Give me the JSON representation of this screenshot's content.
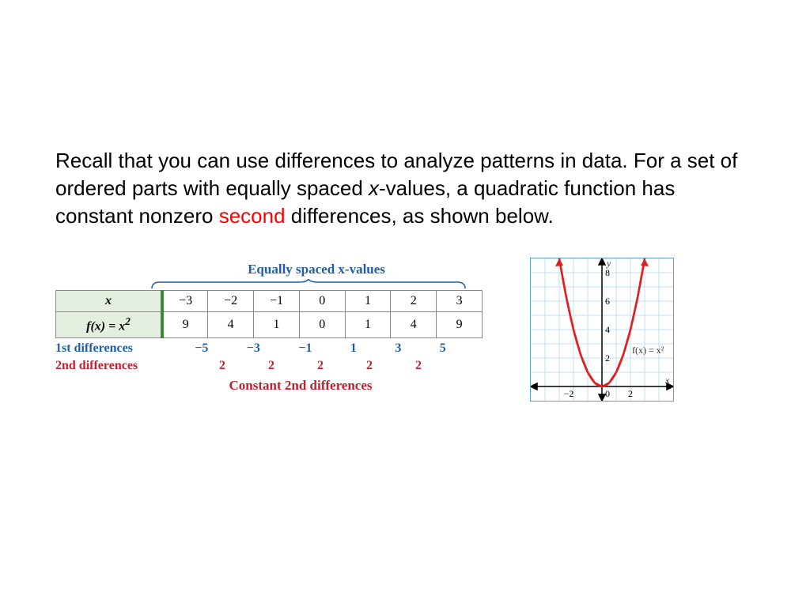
{
  "paragraph": {
    "t1": "Recall that you can use differences to analyze patterns in data. For a set of ordered parts with equally spaced ",
    "x": "x",
    "t2": "-values, a quadratic function has constant nonzero ",
    "second": "second",
    "t3": " differences, as shown below."
  },
  "table": {
    "brace_label": "Equally spaced x-values",
    "row_headers": {
      "x": "x",
      "fx": "f(x) = x",
      "fx_exp": "2"
    },
    "x_vals": [
      "−3",
      "−2",
      "−1",
      "0",
      "1",
      "2",
      "3"
    ],
    "fx_vals": [
      "9",
      "4",
      "1",
      "0",
      "1",
      "4",
      "9"
    ],
    "first_diff_label": "1st differences",
    "first_diffs": [
      "−5",
      "−3",
      "−1",
      "1",
      "3",
      "5"
    ],
    "second_diff_label": "2nd differences",
    "second_diffs": [
      "2",
      "2",
      "2",
      "2",
      "2"
    ],
    "caption": "Constant 2nd differences"
  },
  "chart_data": {
    "type": "line",
    "function_label": "f(x) = x²",
    "x_axis_label": "x",
    "y_axis_label": "y",
    "xlim": [
      -3,
      3
    ],
    "ylim": [
      -1,
      9
    ],
    "x_ticks": [
      -2,
      0,
      2
    ],
    "y_ticks": [
      2,
      4,
      6,
      8
    ],
    "series": [
      {
        "name": "f(x)=x^2",
        "x": [
          -3,
          -2.5,
          -2,
          -1.5,
          -1,
          -0.5,
          0,
          0.5,
          1,
          1.5,
          2,
          2.5,
          3
        ],
        "y": [
          9,
          6.25,
          4,
          2.25,
          1,
          0.25,
          0,
          0.25,
          1,
          2.25,
          4,
          6.25,
          9
        ]
      }
    ]
  }
}
